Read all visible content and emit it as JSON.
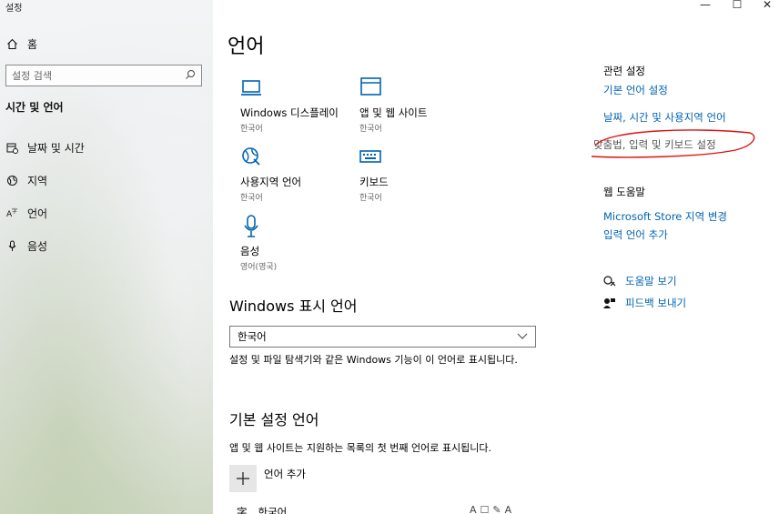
{
  "window": {
    "title": "설정",
    "minimize": "—",
    "maximize": "☐",
    "close": "✕"
  },
  "sidebar": {
    "home": {
      "icon": "home-icon",
      "label": "홈"
    },
    "search": {
      "placeholder": "설정 검색",
      "icon": "search-icon"
    },
    "section_title": "시간 및 언어",
    "items": [
      {
        "icon": "calendar-icon",
        "label": "날짜 및 시간"
      },
      {
        "icon": "globe-icon",
        "label": "지역"
      },
      {
        "icon": "language-icon",
        "label": "언어"
      },
      {
        "icon": "microphone-icon",
        "label": "음성"
      }
    ]
  },
  "main": {
    "title": "언어",
    "tiles": [
      {
        "icon": "laptop-icon",
        "name": "Windows 디스플레이",
        "sub": "한국어"
      },
      {
        "icon": "app-window-icon",
        "name": "앱 및 웹 사이트",
        "sub": "한국어"
      },
      {
        "icon": "regional-globe-icon",
        "name": "사용지역 언어",
        "sub": "한국어"
      },
      {
        "icon": "keyboard-icon",
        "name": "키보드",
        "sub": "한국어"
      },
      {
        "icon": "microphone-icon",
        "name": "음성",
        "sub": "영어(영국)"
      }
    ],
    "display_language": {
      "heading": "Windows 표시 언어",
      "selected": "한국어",
      "description": "설정 및 파일 탐색기와 같은 Windows 기능이 이 언어로 표시됩니다."
    },
    "preferred_language": {
      "heading": "기본 설정 언어",
      "description": "앱 및 웹 사이트는 지원하는 목록의 첫 번째 언어로 표시됩니다.",
      "add_label": "언어 추가",
      "lang_name": "한국어"
    }
  },
  "related": {
    "heading": "관련 설정",
    "links": [
      "기본 언어 설정",
      "날짜, 시간 및 사용지역 언어",
      "맞춤법, 입력 및 키보드 설정"
    ]
  },
  "web_help": {
    "heading": "웹 도움말",
    "links": [
      "Microsoft Store 지역 변경",
      "입력 언어 추가"
    ]
  },
  "support": [
    {
      "icon": "help-chat-icon",
      "label": "도움말 보기"
    },
    {
      "icon": "feedback-icon",
      "label": "피드백 보내기"
    }
  ],
  "annotation_color": "#e01010",
  "accent_color": "#0063b1"
}
